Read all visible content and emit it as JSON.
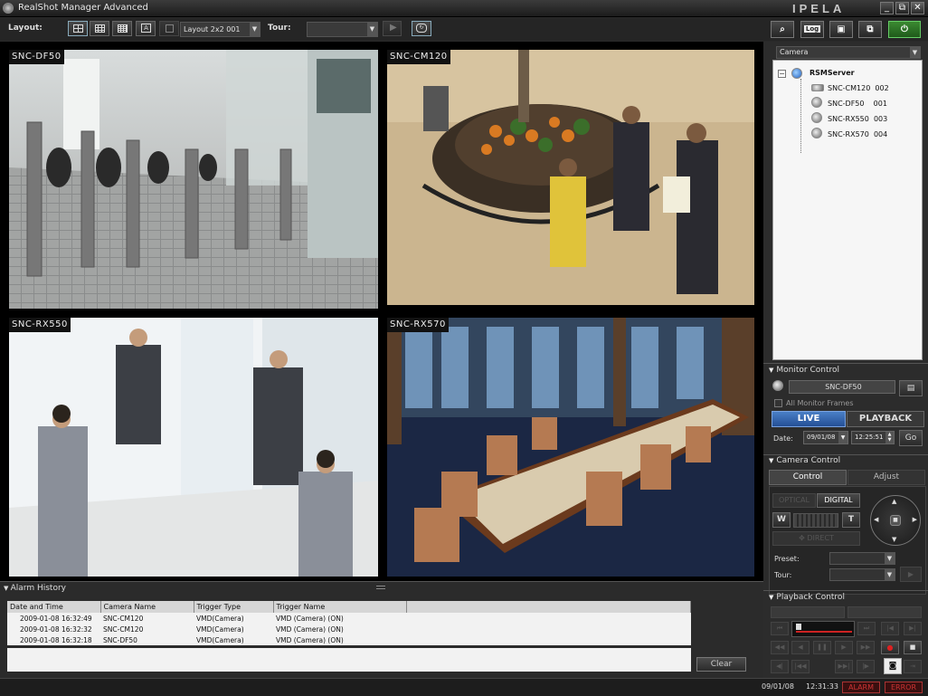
{
  "window": {
    "title": "RealShot Manager Advanced",
    "brand": "IPELA",
    "minimize": "_",
    "maximize": "⧉",
    "close": "✕"
  },
  "toolbar": {
    "layout_label": "Layout:",
    "layout_value": "Layout 2x2 001",
    "tour_label": "Tour:",
    "tour_value": "",
    "text_layout_button": "A"
  },
  "right_tools": {
    "log_label": "Log"
  },
  "video": {
    "frames": [
      {
        "label": "SNC-DF50"
      },
      {
        "label": "SNC-CM120"
      },
      {
        "label": "SNC-RX550"
      },
      {
        "label": "SNC-RX570"
      }
    ]
  },
  "camera_panel": {
    "dropdown": "Camera",
    "server": "RSMServer",
    "cameras": [
      {
        "name": "SNC-CM120",
        "id": "002"
      },
      {
        "name": "SNC-DF50",
        "id": "001"
      },
      {
        "name": "SNC-RX550",
        "id": "003"
      },
      {
        "name": "SNC-RX570",
        "id": "004"
      }
    ]
  },
  "monitor_control": {
    "title": "Monitor Control",
    "camera": "SNC-DF50",
    "all_frames_label": "All Monitor Frames",
    "live": "LIVE",
    "playback": "PLAYBACK",
    "date_label": "Date:",
    "date": "09/01/08",
    "time": "12:25:51",
    "go": "Go"
  },
  "camera_control": {
    "title": "Camera Control",
    "tab_control": "Control",
    "tab_adjust": "Adjust",
    "optical": "OPTICAL",
    "digital": "DIGITAL",
    "wide": "W",
    "tele": "T",
    "direct": "DIRECT",
    "preset_label": "Preset:",
    "tour_label": "Tour:"
  },
  "playback_control": {
    "title": "Playback Control"
  },
  "alarm_history": {
    "title": "Alarm History",
    "columns": [
      "Date and Time",
      "Camera Name",
      "Trigger Type",
      "Trigger Name"
    ],
    "rows": [
      [
        "2009-01-08 16:32:49",
        "SNC-CM120",
        "VMD(Camera)",
        "VMD (Camera) (ON)"
      ],
      [
        "2009-01-08 16:32:32",
        "SNC-CM120",
        "VMD(Camera)",
        "VMD (Camera) (ON)"
      ],
      [
        "2009-01-08 16:32:18",
        "SNC-DF50",
        "VMD(Camera)",
        "VMD (Camera) (ON)"
      ]
    ],
    "clear": "Clear"
  },
  "status": {
    "date": "09/01/08",
    "time": "12:31:33",
    "alarm": "ALARM",
    "error": "ERROR"
  }
}
